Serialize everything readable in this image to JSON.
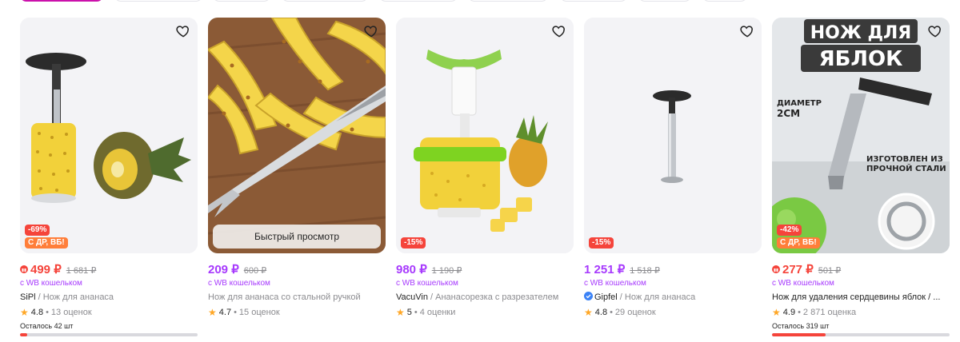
{
  "colors": {
    "accent": "#cb11ab",
    "price_red": "#f5443b",
    "price_purple": "#a73afd",
    "discount_badge": "#f5443b",
    "promo_badge": "#ff7e3a",
    "star": "#ffa726",
    "verified": "#3b82f6"
  },
  "products": [
    {
      "discount": "-69%",
      "promo": "С ДР, ВБ!",
      "price": "499 ₽",
      "old_price": "1 681 ₽",
      "price_style": "red",
      "gift_icon": true,
      "wallet": "с WB кошельком",
      "brand": "SiPl",
      "name": " / Нож для ананаса",
      "rating": "4.8",
      "reviews": "13 оценок",
      "stock_text": "Осталось 42 шт",
      "stock_level": 0.04,
      "image_icon": "pineapple-corer-icon"
    },
    {
      "quick_view": "Быстрый просмотр",
      "price": "209 ₽",
      "old_price": "600 ₽",
      "price_style": "purple",
      "wallet": "с WB кошельком",
      "brand": "",
      "name": "Нож для ананаса со стальной ручкой",
      "rating": "4.7",
      "reviews": "15 оценок",
      "image_icon": "pineapple-knife-photo-icon"
    },
    {
      "discount": "-15%",
      "price": "980 ₽",
      "old_price": "1 190 ₽",
      "price_style": "purple",
      "wallet": "с WB кошельком",
      "brand": "VacuVin",
      "name": " / Ананасорезка с разрезателем",
      "rating": "5",
      "reviews": "4 оценки",
      "image_icon": "pineapple-slicer-icon"
    },
    {
      "discount": "-15%",
      "price": "1 251 ₽",
      "old_price": "1 518 ₽",
      "price_style": "purple",
      "wallet": "с WB кошельком",
      "brand": "Gipfel",
      "verified": true,
      "name": " / Нож для ананаса",
      "rating": "4.8",
      "reviews": "29 оценок",
      "image_icon": "steel-corer-icon"
    },
    {
      "discount": "-42%",
      "promo": "С ДР, ВБ!",
      "price": "277 ₽",
      "old_price": "501 ₽",
      "price_style": "red",
      "gift_icon": true,
      "wallet": "с WB кошельком",
      "brand": "",
      "name": "Нож для удаления сердцевины яблок / ...",
      "rating": "4.9",
      "reviews": "2 871 оценка",
      "stock_text": "Осталось 319 шт",
      "stock_level": 0.3,
      "image_icon": "apple-corer-icon",
      "banner": {
        "line1": "НОЖ ДЛЯ",
        "line2": "ЯБЛОК",
        "diameter": "ДИАМЕТР",
        "diameter_val": "2СМ",
        "steel1": "ИЗГОТОВЛЕН ИЗ",
        "steel2": "ПРОЧНОЙ СТАЛИ"
      }
    }
  ]
}
